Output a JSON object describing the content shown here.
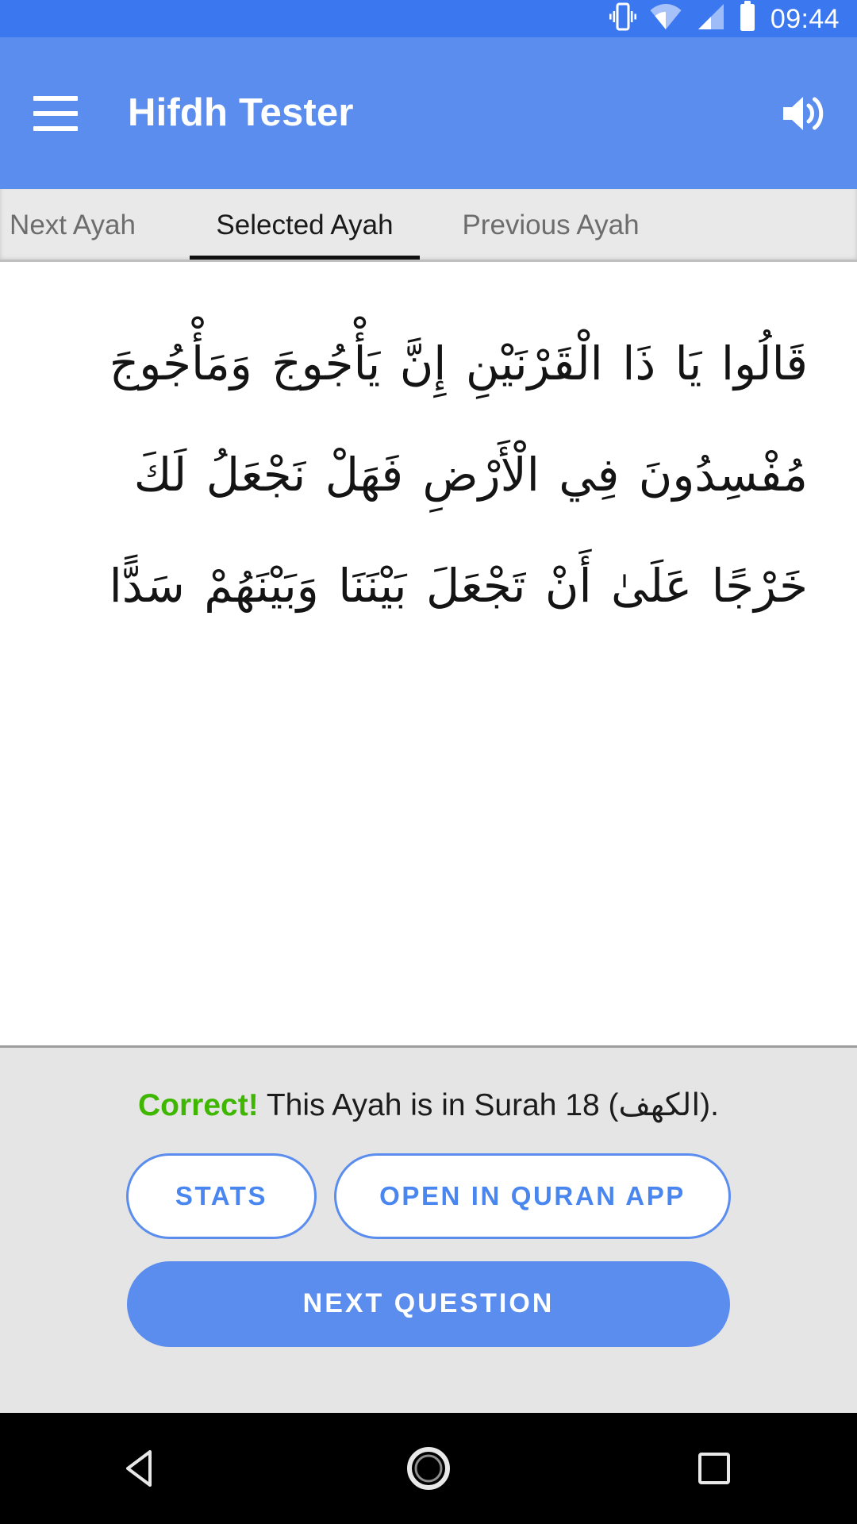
{
  "status_bar": {
    "time": "09:44",
    "icons": [
      "vibrate-icon",
      "wifi-icon",
      "cell-signal-icon",
      "battery-icon"
    ],
    "background_color": "#3b78f0"
  },
  "app_bar": {
    "title": "Hifdh Tester",
    "menu_icon": "hamburger-menu-icon",
    "action_icon": "volume-up-icon",
    "background_color": "#5b8def"
  },
  "tabs": {
    "items": [
      {
        "label": "Next Ayah",
        "active": false
      },
      {
        "label": "Selected Ayah",
        "active": true
      },
      {
        "label": "Previous Ayah",
        "active": false
      }
    ],
    "indicator_color": "#111111",
    "background_color": "#e9e9e9"
  },
  "ayah": {
    "text": "قَالُوا يَا ذَا الْقَرْنَيْنِ إِنَّ يَأْجُوجَ وَمَأْجُوجَ مُفْسِدُونَ فِي الْأَرْضِ فَهَلْ نَجْعَلُ لَكَ خَرْجًا عَلَىٰ أَنْ تَجْعَلَ بَيْنَنَا وَبَيْنَهُمْ سَدًّا",
    "lines": [
      "قَالُوا يَا ذَا الْقَرْنَيْنِ إِنَّ يَأْجُوجَ",
      "وَمَأْجُوجَ مُفْسِدُونَ فِي الْأَرْضِ فَهَلْ",
      "نَجْعَلُ لَكَ خَرْجًا عَلَىٰ أَنْ تَجْعَلَ بَيْنَنَا",
      "وَبَيْنَهُمْ سَدًّا"
    ]
  },
  "result": {
    "verdict": "Correct!",
    "message_prefix": " This Ayah is in Surah 18 (",
    "surah_number": "18",
    "surah_name_arabic": "الكهف",
    "message_suffix": ").",
    "verdict_color": "#3fb700"
  },
  "actions": {
    "stats_label": "STATS",
    "open_quran_label": "OPEN IN QURAN APP",
    "next_question_label": "NEXT QUESTION",
    "accent_color": "#5b8def"
  },
  "nav_bar": {
    "back_icon": "back-triangle-icon",
    "home_icon": "home-circle-icon",
    "recents_icon": "recents-square-icon",
    "background_color": "#000000"
  }
}
